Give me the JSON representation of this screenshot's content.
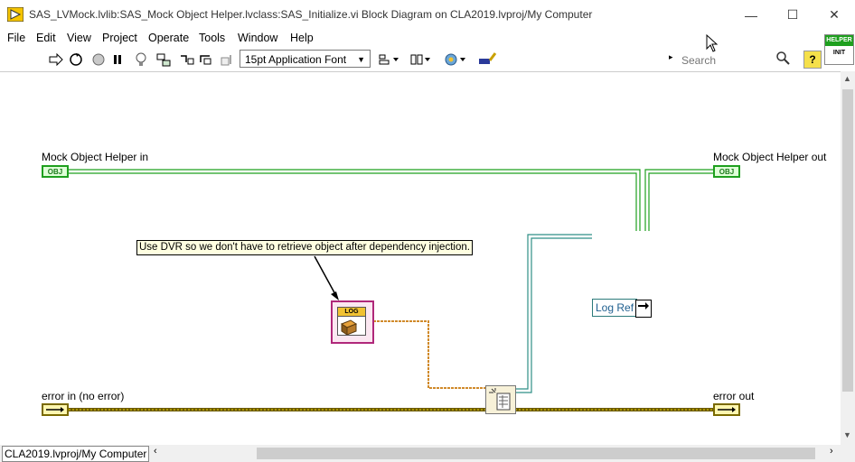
{
  "window": {
    "title": "SAS_LVMock.lvlib:SAS_Mock Object Helper.lvclass:SAS_Initialize.vi Block Diagram on CLA2019.lvproj/My Computer",
    "minimize": "—",
    "maximize": "☐",
    "close": "✕"
  },
  "menu": [
    "File",
    "Edit",
    "View",
    "Project",
    "Operate",
    "Tools",
    "Window",
    "Help"
  ],
  "toolbar": {
    "font": "15pt Application Font",
    "search_placeholder": "Search",
    "help": "?"
  },
  "connector_pane": {
    "top": "HELPER",
    "bottom": "INIT"
  },
  "diagram": {
    "input_obj_label": "Mock Object Helper in",
    "output_obj_label": "Mock Object Helper out",
    "error_in_label": "error in (no error)",
    "error_out_label": "error out",
    "comment": "Use DVR so we don't have to retrieve object after dependency injection.",
    "log_ref_label": "Log Ref",
    "log_badge": "LOG",
    "obj_term": "OBJ"
  },
  "status": {
    "path": "CLA2019.lvproj/My Computer"
  },
  "colors": {
    "class_wire": "#1ea01e",
    "error_wire": "#6b5a00",
    "dvr_wire": "#2f8f86",
    "log_wire": "#d08a2b"
  }
}
